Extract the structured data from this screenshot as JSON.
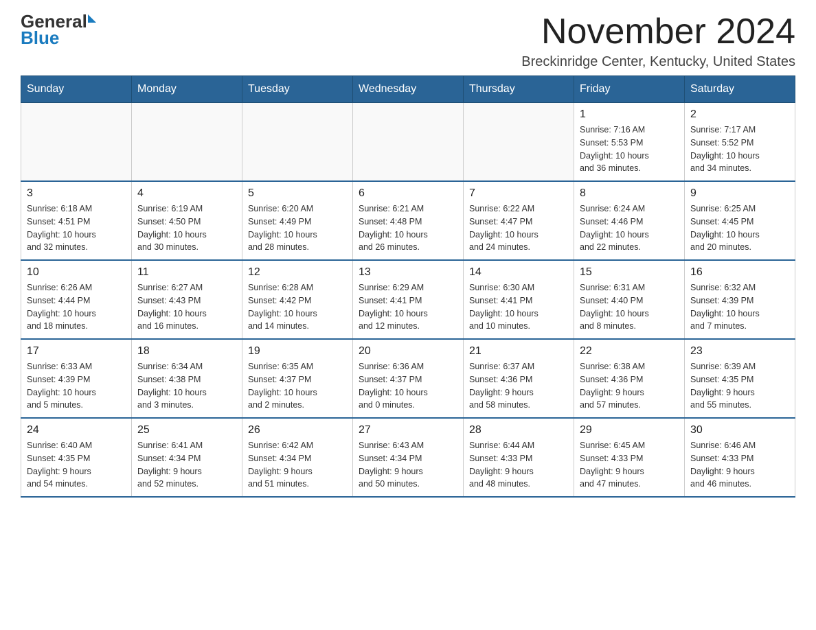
{
  "header": {
    "logo_text_general": "General",
    "logo_text_blue": "Blue",
    "month_year": "November 2024",
    "location": "Breckinridge Center, Kentucky, United States"
  },
  "days_of_week": [
    "Sunday",
    "Monday",
    "Tuesday",
    "Wednesday",
    "Thursday",
    "Friday",
    "Saturday"
  ],
  "weeks": [
    [
      {
        "day": "",
        "info": ""
      },
      {
        "day": "",
        "info": ""
      },
      {
        "day": "",
        "info": ""
      },
      {
        "day": "",
        "info": ""
      },
      {
        "day": "",
        "info": ""
      },
      {
        "day": "1",
        "info": "Sunrise: 7:16 AM\nSunset: 5:53 PM\nDaylight: 10 hours\nand 36 minutes."
      },
      {
        "day": "2",
        "info": "Sunrise: 7:17 AM\nSunset: 5:52 PM\nDaylight: 10 hours\nand 34 minutes."
      }
    ],
    [
      {
        "day": "3",
        "info": "Sunrise: 6:18 AM\nSunset: 4:51 PM\nDaylight: 10 hours\nand 32 minutes."
      },
      {
        "day": "4",
        "info": "Sunrise: 6:19 AM\nSunset: 4:50 PM\nDaylight: 10 hours\nand 30 minutes."
      },
      {
        "day": "5",
        "info": "Sunrise: 6:20 AM\nSunset: 4:49 PM\nDaylight: 10 hours\nand 28 minutes."
      },
      {
        "day": "6",
        "info": "Sunrise: 6:21 AM\nSunset: 4:48 PM\nDaylight: 10 hours\nand 26 minutes."
      },
      {
        "day": "7",
        "info": "Sunrise: 6:22 AM\nSunset: 4:47 PM\nDaylight: 10 hours\nand 24 minutes."
      },
      {
        "day": "8",
        "info": "Sunrise: 6:24 AM\nSunset: 4:46 PM\nDaylight: 10 hours\nand 22 minutes."
      },
      {
        "day": "9",
        "info": "Sunrise: 6:25 AM\nSunset: 4:45 PM\nDaylight: 10 hours\nand 20 minutes."
      }
    ],
    [
      {
        "day": "10",
        "info": "Sunrise: 6:26 AM\nSunset: 4:44 PM\nDaylight: 10 hours\nand 18 minutes."
      },
      {
        "day": "11",
        "info": "Sunrise: 6:27 AM\nSunset: 4:43 PM\nDaylight: 10 hours\nand 16 minutes."
      },
      {
        "day": "12",
        "info": "Sunrise: 6:28 AM\nSunset: 4:42 PM\nDaylight: 10 hours\nand 14 minutes."
      },
      {
        "day": "13",
        "info": "Sunrise: 6:29 AM\nSunset: 4:41 PM\nDaylight: 10 hours\nand 12 minutes."
      },
      {
        "day": "14",
        "info": "Sunrise: 6:30 AM\nSunset: 4:41 PM\nDaylight: 10 hours\nand 10 minutes."
      },
      {
        "day": "15",
        "info": "Sunrise: 6:31 AM\nSunset: 4:40 PM\nDaylight: 10 hours\nand 8 minutes."
      },
      {
        "day": "16",
        "info": "Sunrise: 6:32 AM\nSunset: 4:39 PM\nDaylight: 10 hours\nand 7 minutes."
      }
    ],
    [
      {
        "day": "17",
        "info": "Sunrise: 6:33 AM\nSunset: 4:39 PM\nDaylight: 10 hours\nand 5 minutes."
      },
      {
        "day": "18",
        "info": "Sunrise: 6:34 AM\nSunset: 4:38 PM\nDaylight: 10 hours\nand 3 minutes."
      },
      {
        "day": "19",
        "info": "Sunrise: 6:35 AM\nSunset: 4:37 PM\nDaylight: 10 hours\nand 2 minutes."
      },
      {
        "day": "20",
        "info": "Sunrise: 6:36 AM\nSunset: 4:37 PM\nDaylight: 10 hours\nand 0 minutes."
      },
      {
        "day": "21",
        "info": "Sunrise: 6:37 AM\nSunset: 4:36 PM\nDaylight: 9 hours\nand 58 minutes."
      },
      {
        "day": "22",
        "info": "Sunrise: 6:38 AM\nSunset: 4:36 PM\nDaylight: 9 hours\nand 57 minutes."
      },
      {
        "day": "23",
        "info": "Sunrise: 6:39 AM\nSunset: 4:35 PM\nDaylight: 9 hours\nand 55 minutes."
      }
    ],
    [
      {
        "day": "24",
        "info": "Sunrise: 6:40 AM\nSunset: 4:35 PM\nDaylight: 9 hours\nand 54 minutes."
      },
      {
        "day": "25",
        "info": "Sunrise: 6:41 AM\nSunset: 4:34 PM\nDaylight: 9 hours\nand 52 minutes."
      },
      {
        "day": "26",
        "info": "Sunrise: 6:42 AM\nSunset: 4:34 PM\nDaylight: 9 hours\nand 51 minutes."
      },
      {
        "day": "27",
        "info": "Sunrise: 6:43 AM\nSunset: 4:34 PM\nDaylight: 9 hours\nand 50 minutes."
      },
      {
        "day": "28",
        "info": "Sunrise: 6:44 AM\nSunset: 4:33 PM\nDaylight: 9 hours\nand 48 minutes."
      },
      {
        "day": "29",
        "info": "Sunrise: 6:45 AM\nSunset: 4:33 PM\nDaylight: 9 hours\nand 47 minutes."
      },
      {
        "day": "30",
        "info": "Sunrise: 6:46 AM\nSunset: 4:33 PM\nDaylight: 9 hours\nand 46 minutes."
      }
    ]
  ]
}
